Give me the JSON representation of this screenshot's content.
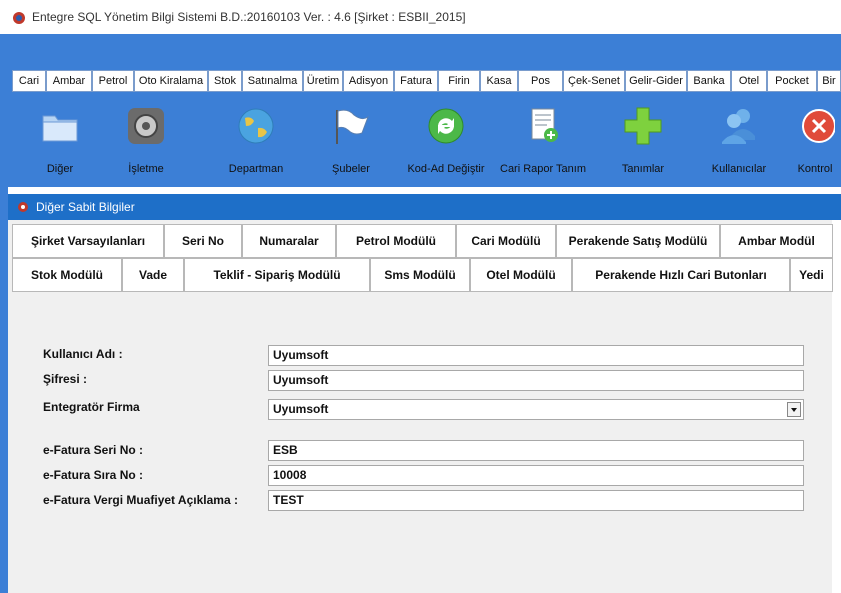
{
  "window": {
    "title": "Entegre SQL Yönetim Bilgi Sistemi B.D.:20160103 Ver. : 4.6 [Şirket : ESBII_2015]"
  },
  "menu": [
    "Cari",
    "Ambar",
    "Petrol",
    "Oto Kiralama",
    "Stok",
    "Satınalma",
    "Üretim",
    "Adisyon",
    "Fatura",
    "Firin",
    "Kasa",
    "Pos",
    "Çek-Senet",
    "Gelir-Gider",
    "Banka",
    "Otel",
    "Pocket",
    "Bir"
  ],
  "toolbar": [
    "Diğer",
    "İşletme",
    "Departman",
    "Şubeler",
    "Kod-Ad Değiştir",
    "Cari Rapor Tanım",
    "Tanımlar",
    "Kullanıcılar",
    "Kontrol"
  ],
  "subwindow": {
    "title": "Diğer Sabit Bilgiler"
  },
  "tabs_row1": [
    "Şirket Varsayılanları",
    "Seri No",
    "Numaralar",
    "Petrol Modülü",
    "Cari Modülü",
    "Perakende Satış Modülü",
    "Ambar Modül"
  ],
  "tabs_row2": [
    "Stok Modülü",
    "Vade",
    "Teklif - Sipariş Modülü",
    "Sms Modülü",
    "Otel Modülü",
    "Perakende Hızlı Cari Butonları",
    "Yedi"
  ],
  "form": {
    "username_label": "Kullanıcı Adı :",
    "username_value": "Uyumsoft",
    "password_label": "Şifresi :",
    "password_value": "Uyumsoft",
    "integrator_label": "Entegratör Firma",
    "integrator_value": "Uyumsoft",
    "series_label": "e-Fatura Seri No :",
    "series_value": "ESB",
    "sequence_label": "e-Fatura Sıra No :",
    "sequence_value": "10008",
    "tax_label": "e-Fatura Vergi Muafiyet Açıklama :",
    "tax_value": "TEST"
  },
  "colors": {
    "band": "#3c7fd6",
    "subtitle": "#1e6fc8",
    "form_bg": "#f0f0f0"
  }
}
